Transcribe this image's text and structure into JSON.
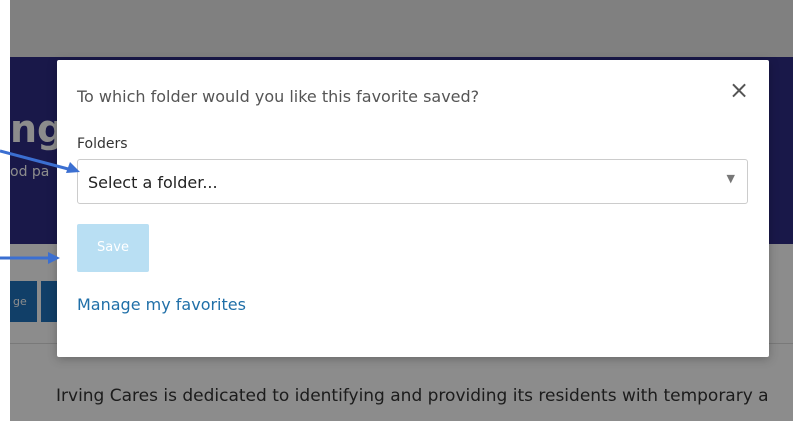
{
  "background": {
    "hero_title": "ng C",
    "hero_subtitle": "od pa",
    "tab_1_label": "ge",
    "body_text": "Irving Cares is dedicated to identifying and providing its residents with temporary a"
  },
  "modal": {
    "title": "To which folder would you like this favorite saved?",
    "close_glyph": "×",
    "folders_label": "Folders",
    "folder_select_value": "Select a folder...",
    "chevron_glyph": "▼",
    "save_label": "Save",
    "manage_link": "Manage my favorites"
  },
  "colors": {
    "hero": "#2f2d86",
    "tab_button": "#1f73bd",
    "save_disabled": "#b9dff3",
    "link": "#1f6fa8",
    "annotation_arrow": "#3b6fd1"
  }
}
